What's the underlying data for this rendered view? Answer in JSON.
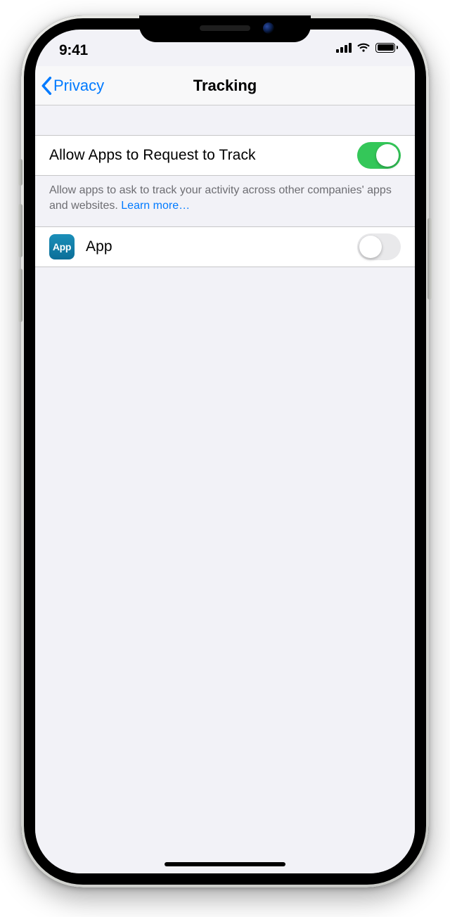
{
  "status": {
    "time": "9:41"
  },
  "nav": {
    "back_label": "Privacy",
    "title": "Tracking"
  },
  "main_toggle": {
    "label": "Allow Apps to Request to Track",
    "on": true
  },
  "footer": {
    "text": "Allow apps to ask to track your activity across other companies' apps and websites. ",
    "link": "Learn more…"
  },
  "apps": [
    {
      "icon_text": "App",
      "name": "App",
      "on": false
    }
  ]
}
